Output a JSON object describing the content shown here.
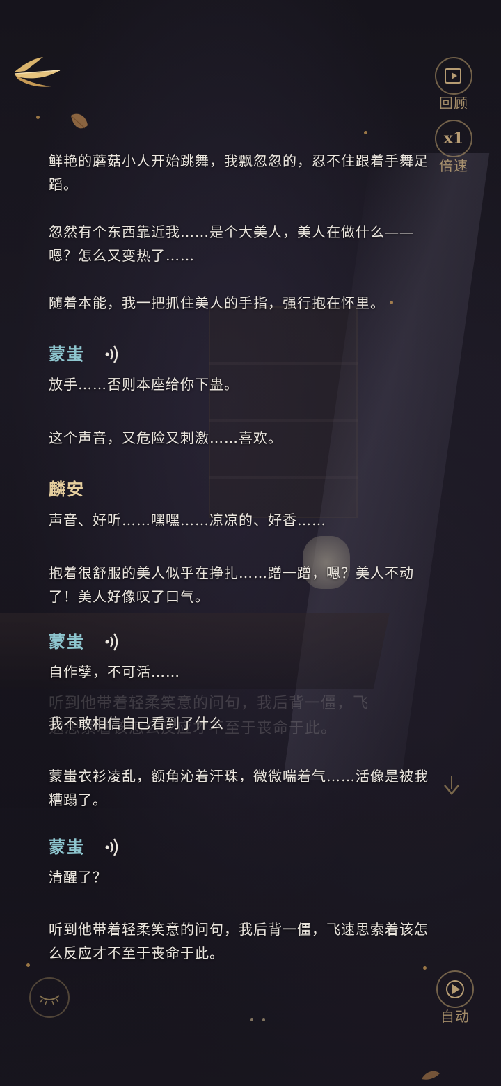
{
  "controls": {
    "review_label": "回顾",
    "speed_value": "x1",
    "speed_label": "倍速",
    "auto_label": "自动"
  },
  "dialogue": [
    {
      "kind": "narration",
      "text": "鲜艳的蘑菇小人开始跳舞，我飘忽忽的，忍不住跟着手舞足蹈。"
    },
    {
      "kind": "narration",
      "text": "忽然有个东西靠近我……是个大美人，美人在做什么——嗯？怎么又变热了……"
    },
    {
      "kind": "narration",
      "text": "随着本能，我一把抓住美人的手指，强行抱在怀里。"
    },
    {
      "kind": "speaker",
      "name": "蒙蚩"
    },
    {
      "kind": "speech",
      "text": "放手……否则本座给你下蛊。"
    },
    {
      "kind": "narration",
      "text": "这个声音，又危险又刺激……喜欢。"
    },
    {
      "kind": "speaker",
      "name": "麟安"
    },
    {
      "kind": "speech",
      "text": "声音、好听……嘿嘿……凉凉的、好香……"
    },
    {
      "kind": "narration",
      "text": "抱着很舒服的美人似乎在挣扎……蹭一蹭，嗯？美人不动了！美人好像叹了口气。"
    },
    {
      "kind": "speaker",
      "name": "蒙蚩"
    },
    {
      "kind": "speech",
      "text": "自作孽，不可活……"
    },
    {
      "kind": "narration",
      "text": "我不敢相信自己看到了什么"
    },
    {
      "kind": "narration",
      "text": "蒙蚩衣衫凌乱，额角沁着汗珠，微微喘着气……活像是被我糟蹋了。"
    },
    {
      "kind": "speaker",
      "name": "蒙蚩"
    },
    {
      "kind": "speech",
      "text": "清醒了？"
    },
    {
      "kind": "narration",
      "text": "听到他带着轻柔笑意的问句，我后背一僵，飞速思索着该怎么反应才不至于丧命于此。"
    }
  ],
  "ghost_text": {
    "line1": "听到他带着轻柔笑意的问句，我后背一僵，飞",
    "line2": "速思索着该怎么反应才不至于丧命于此。"
  },
  "icons": {
    "back": "golden-leaf-back-icon",
    "review": "replay-icon",
    "voice": "sound-wave-icon",
    "eye": "closed-eye-icon",
    "auto": "play-icon",
    "arrow": "down-arrow-icon"
  },
  "colors": {
    "accent_gold": "#d6b06a",
    "speaker_meng": "#8ec6cf",
    "speaker_lin": "#e6cf9e",
    "text": "#ece7df"
  }
}
